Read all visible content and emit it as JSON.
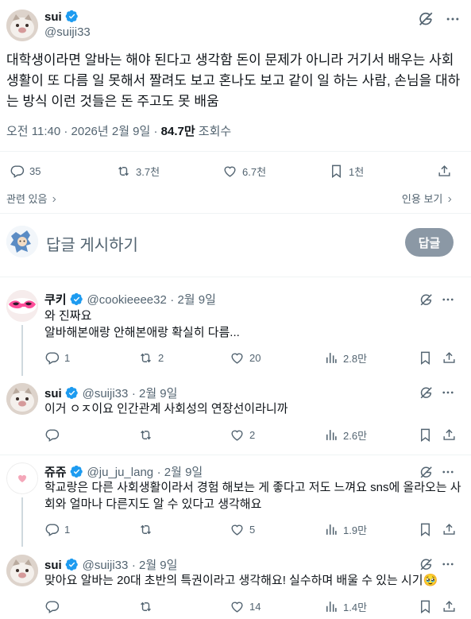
{
  "main_post": {
    "author_name": "sui",
    "author_handle": "@suiji33",
    "text": "대학생이라면 알바는 해야 된다고 생각함 돈이 문제가 아니라 거기서 배우는 사회 생활이 또 다름 일 못해서 짤려도 보고 혼나도 보고 같이 일 하는 사람, 손님을 대하는 방식 이런 것들은 돈 주고도 못 배움",
    "time": "오전 11:40 · 2026년 2월 9일 · ",
    "views_count": "84.7만",
    "views_label": " 조회수",
    "replies": "35",
    "reposts": "3.7천",
    "likes": "6.7천",
    "bookmarks": "1천",
    "related_label": "관련 있음",
    "quote_view_label": "인용 보기"
  },
  "reply_composer": {
    "placeholder": "답글 게시하기",
    "button_label": "답글"
  },
  "replies": [
    {
      "author_name": "쿠키",
      "author_handle": "@cookieeee32",
      "date": "· 2월 9일",
      "line1": "와 진짜요",
      "line2": "알바해본애랑 안해본애랑 확실히 다름...",
      "replies": "1",
      "reposts": "2",
      "likes": "20",
      "views": "2.8만"
    },
    {
      "author_name": "sui",
      "author_handle": "@suiji33",
      "date": "· 2월 9일",
      "line1": "이거 ㅇㅈ이요 인간관계 사회성의 연장선이라니까",
      "replies": "",
      "reposts": "",
      "likes": "2",
      "views": "2.6만"
    },
    {
      "author_name": "쥬쥬",
      "author_handle": "@ju_ju_lang",
      "date": "· 2월 9일",
      "line1": "학교랑은 다른 사회생활이라서 경험 해보는 게 좋다고 저도 느껴요 sns에 올라오는 사",
      "line2": "회와 얼마나 다른지도 알 수 있다고 생각해요",
      "replies": "1",
      "reposts": "",
      "likes": "5",
      "views": "1.9만"
    },
    {
      "author_name": "sui",
      "author_handle": "@suiji33",
      "date": "· 2월 9일",
      "line1": "맞아요 알바는 20대 초반의 특권이라고 생각해요! 실수하며 배울 수 있는 시기",
      "emoji": "🥹",
      "replies": "",
      "reposts": "",
      "likes": "14",
      "views": "1.4만"
    }
  ],
  "colors": {
    "verified": "#1d9bf0",
    "text": "#0f1419",
    "secondary": "#536471",
    "reply_button": "#8b98a5"
  }
}
